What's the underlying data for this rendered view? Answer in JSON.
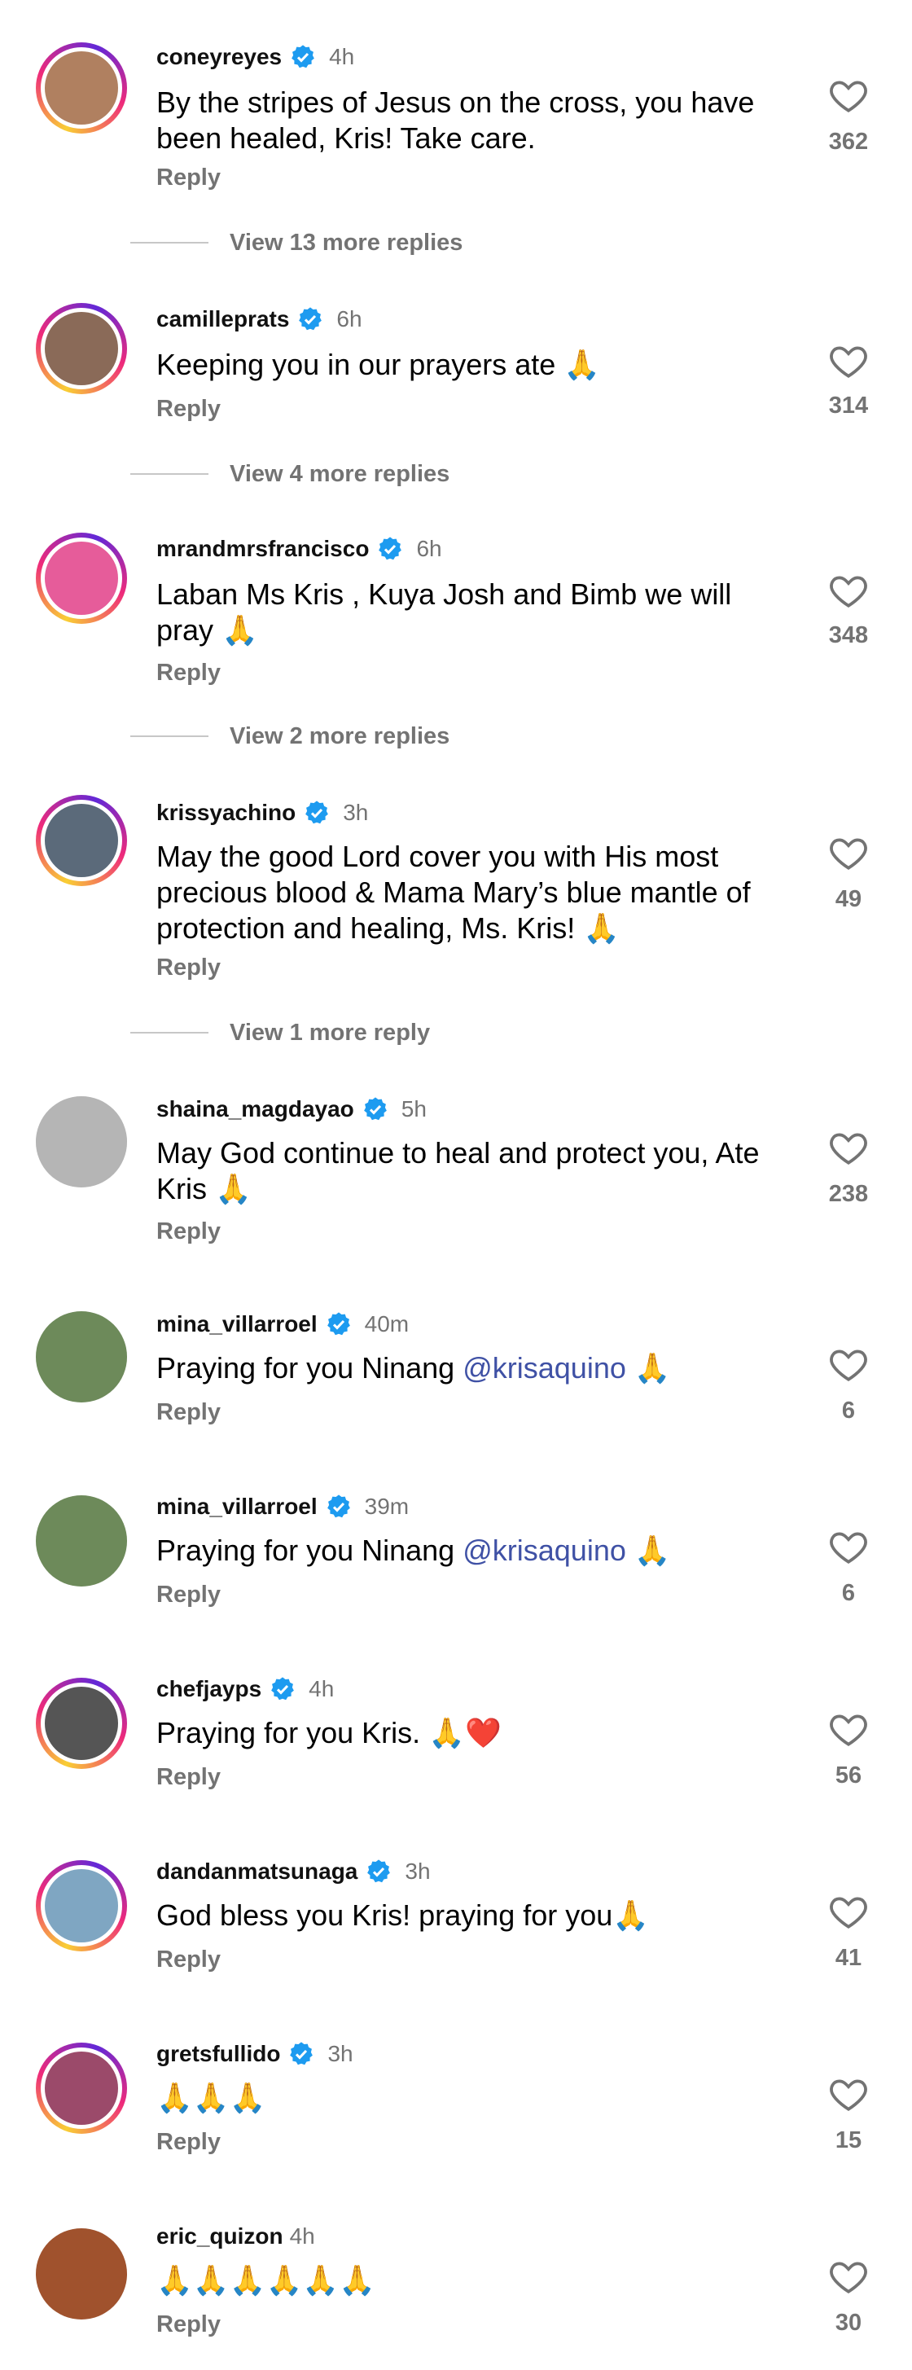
{
  "verified_color": "#1d9bf0",
  "comments": [
    {
      "username": "coneyreyes",
      "time": "4h",
      "text": "By the stripes of Jesus on the cross, you have been healed, Kris! Take care.",
      "reply": "Reply",
      "likes": "362",
      "more": "View 13 more replies",
      "avatar_icon": "avatar-coneyreyes",
      "avatar_color": "#b08060"
    },
    {
      "username": "camilleprats",
      "time": "6h",
      "text": "Keeping you in our prayers ate 🙏",
      "reply": "Reply",
      "likes": "314",
      "more": "View 4 more replies",
      "avatar_icon": "avatar-camilleprats",
      "avatar_color": "#8a6a58"
    },
    {
      "username": "mrandmrsfrancisco",
      "time": "6h",
      "text": "Laban Ms Kris , Kuya Josh and Bimb we will pray 🙏",
      "reply": "Reply",
      "likes": "348",
      "more": "View 2 more replies",
      "avatar_icon": "avatar-mrandmrsfrancisco",
      "avatar_color": "#e65c9a"
    },
    {
      "username": "krissyachino",
      "time": "3h",
      "text": "May the good Lord cover you with His most precious blood & Mama Mary’s blue mantle of protection and healing, Ms. Kris! 🙏",
      "reply": "Reply",
      "likes": "49",
      "more": "View 1 more reply",
      "avatar_icon": "avatar-krissyachino",
      "avatar_color": "#5b6a7a"
    },
    {
      "username": "shaina_magdayao",
      "time": "5h",
      "text": "May God continue to heal and protect you, Ate Kris 🙏",
      "reply": "Reply",
      "likes": "238",
      "avatar_icon": "avatar-shaina",
      "avatar_color": "#b5b5b5"
    },
    {
      "username": "mina_villarroel",
      "time": "40m",
      "text_pre": "Praying for you Ninang ",
      "mention": "@krisaquino",
      "text_post": " 🙏",
      "reply": "Reply",
      "likes": "6",
      "avatar_icon": "avatar-mina",
      "avatar_color": "#6d8a5a"
    },
    {
      "username": "mina_villarroel",
      "time": "39m",
      "text_pre": "Praying for you Ninang ",
      "mention": "@krisaquino",
      "text_post": " 🙏",
      "reply": "Reply",
      "likes": "6",
      "avatar_icon": "avatar-mina",
      "avatar_color": "#6d8a5a"
    },
    {
      "username": "chefjayps",
      "time": "4h",
      "text": "Praying for you Kris. 🙏❤️",
      "reply": "Reply",
      "likes": "56",
      "avatar_icon": "avatar-chefjayps",
      "avatar_color": "#555555"
    },
    {
      "username": "dandanmatsunaga",
      "time": "3h",
      "text": "God bless you Kris! praying for you🙏",
      "reply": "Reply",
      "likes": "41",
      "avatar_icon": "avatar-dandan",
      "avatar_color": "#7fa6c2"
    },
    {
      "username": "gretsfullido",
      "time": "3h",
      "text": "🙏🙏🙏",
      "reply": "Reply",
      "likes": "15",
      "avatar_icon": "avatar-grets",
      "avatar_color": "#9b4a6a"
    },
    {
      "username": "eric_quizon",
      "time": "4h",
      "text": "🙏🙏🙏🙏🙏🙏",
      "reply": "Reply",
      "likes": "30",
      "avatar_icon": "avatar-eric",
      "avatar_color": "#a0522d"
    }
  ]
}
